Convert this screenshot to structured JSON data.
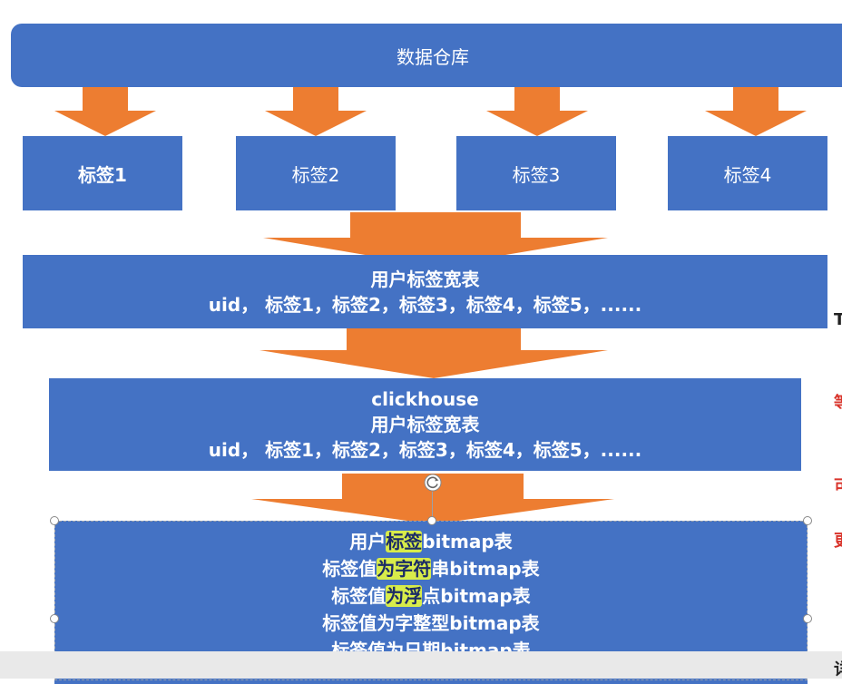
{
  "diagram": {
    "warehouse": "数据仓库",
    "tags": [
      "标签1",
      "标签2",
      "标签3",
      "标签4"
    ],
    "wide_table": {
      "title": "用户标签宽表",
      "columns": "uid， 标签1，标签2，标签3，标签4，标签5，......"
    },
    "clickhouse_table": {
      "engine": "clickhouse",
      "title": "用户标签宽表",
      "columns": "uid， 标签1，标签2，标签3，标签4，标签5，......"
    },
    "bitmap_table": {
      "line1_pre": "用户",
      "line1_hl": "标签",
      "line1_post": "bitmap表",
      "line2_pre": "标签值",
      "line2_hl": "为字符",
      "line2_post": "串bitmap表",
      "line3_pre": "标签值",
      "line3_hl": "为浮",
      "line3_post": "点bitmap表",
      "line4": "标签值为字整型bitmap表",
      "line5": "标签值为日期bitmap表"
    }
  },
  "colors": {
    "box_fill": "#4472c4",
    "arrow_fill": "#ed7d31",
    "highlight": "#d8ec4a",
    "edge_red": "#d9342b"
  },
  "edge": {
    "glyph_1": "T",
    "glyph_2": "等",
    "glyph_3": "可",
    "glyph_4": "更",
    "glyph_5": "详"
  }
}
